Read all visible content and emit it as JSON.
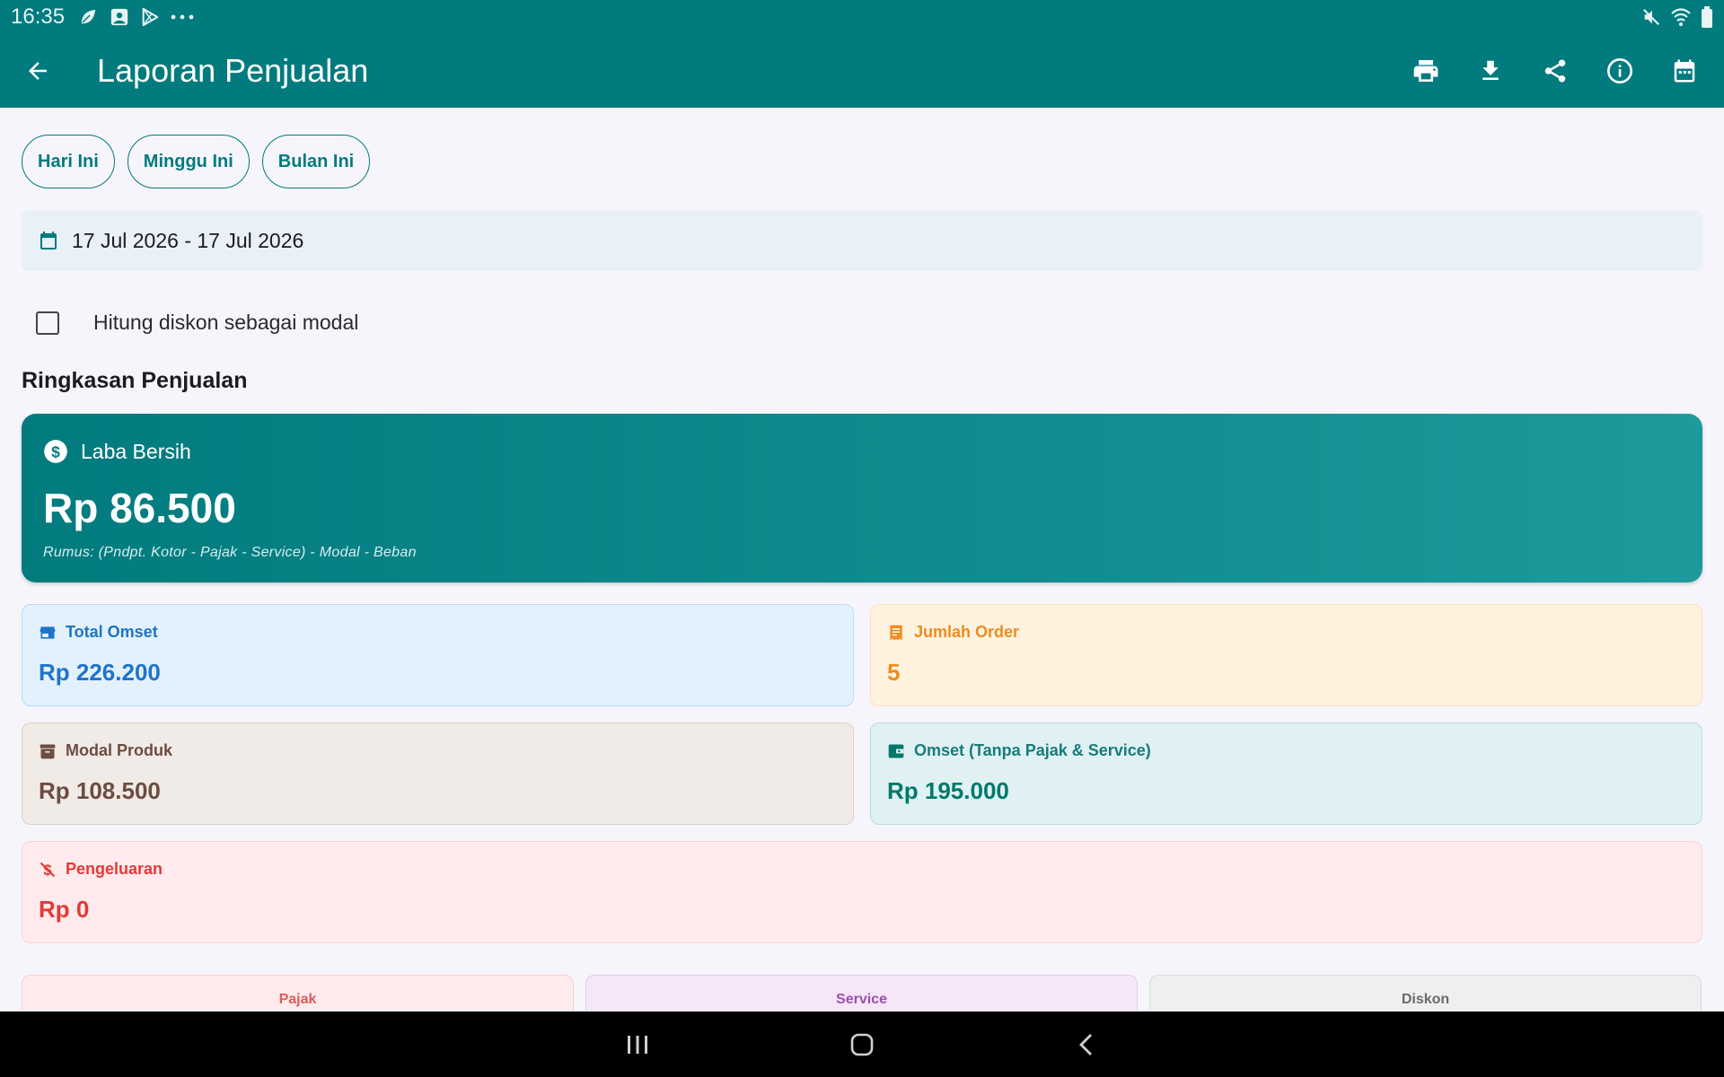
{
  "status_bar": {
    "time": "16:35"
  },
  "app_bar": {
    "title": "Laporan Penjualan"
  },
  "filters": {
    "chips": [
      "Hari Ini",
      "Minggu Ini",
      "Bulan Ini"
    ]
  },
  "date_range": "17 Jul 2026 - 17 Jul 2026",
  "checkbox": {
    "label": "Hitung diskon sebagai modal",
    "checked": false
  },
  "summary": {
    "title": "Ringkasan Penjualan",
    "net_profit": {
      "label": "Laba Bersih",
      "value": "Rp 86.500",
      "formula": "Rumus: (Pndpt. Kotor - Pajak - Service) - Modal - Beban"
    },
    "total_omset": {
      "label": "Total Omset",
      "value": "Rp 226.200"
    },
    "order_count": {
      "label": "Jumlah Order",
      "value": "5"
    },
    "product_cost": {
      "label": "Modal Produk",
      "value": "Rp 108.500"
    },
    "omset_net": {
      "label": "Omset (Tanpa Pajak & Service)",
      "value": "Rp 195.000"
    },
    "expenses": {
      "label": "Pengeluaran",
      "value": "Rp 0"
    },
    "mini_cards": {
      "tax": "Pajak",
      "service": "Service",
      "discount": "Diskon"
    }
  },
  "colors": {
    "primary": "#017b7e",
    "blue": "#1e74c8",
    "orange": "#ef8b1f",
    "brown": "#6d4c41",
    "teal": "#00796b",
    "red": "#e53935"
  }
}
